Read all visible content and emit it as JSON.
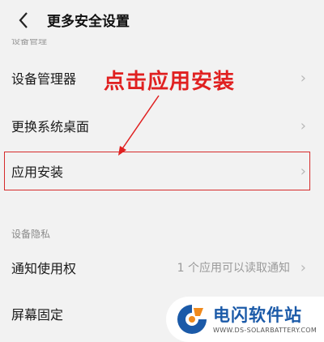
{
  "header": {
    "back_icon": "chevron-left-icon",
    "title": "更多安全设置"
  },
  "cut_section_label": "设备管理",
  "rows": [
    {
      "label": "设备管理器",
      "value": ""
    },
    {
      "label": "更换系统桌面",
      "value": ""
    },
    {
      "label": "应用安装",
      "value": ""
    },
    {
      "label": "通知使用权",
      "value": "1 个应用可以读取通知"
    },
    {
      "label": "屏幕固定",
      "value": ""
    }
  ],
  "section_privacy": "设备隐私",
  "annotation": {
    "text": "点击应用安装",
    "color": "#e02020"
  },
  "watermark": {
    "name": "电闪软件站",
    "url": "WWW.DS-SOLARBATTERY.COM"
  },
  "colors": {
    "background": "#f2f2f2",
    "highlight": "#d62b2b",
    "brand": "#1b5aa8"
  }
}
